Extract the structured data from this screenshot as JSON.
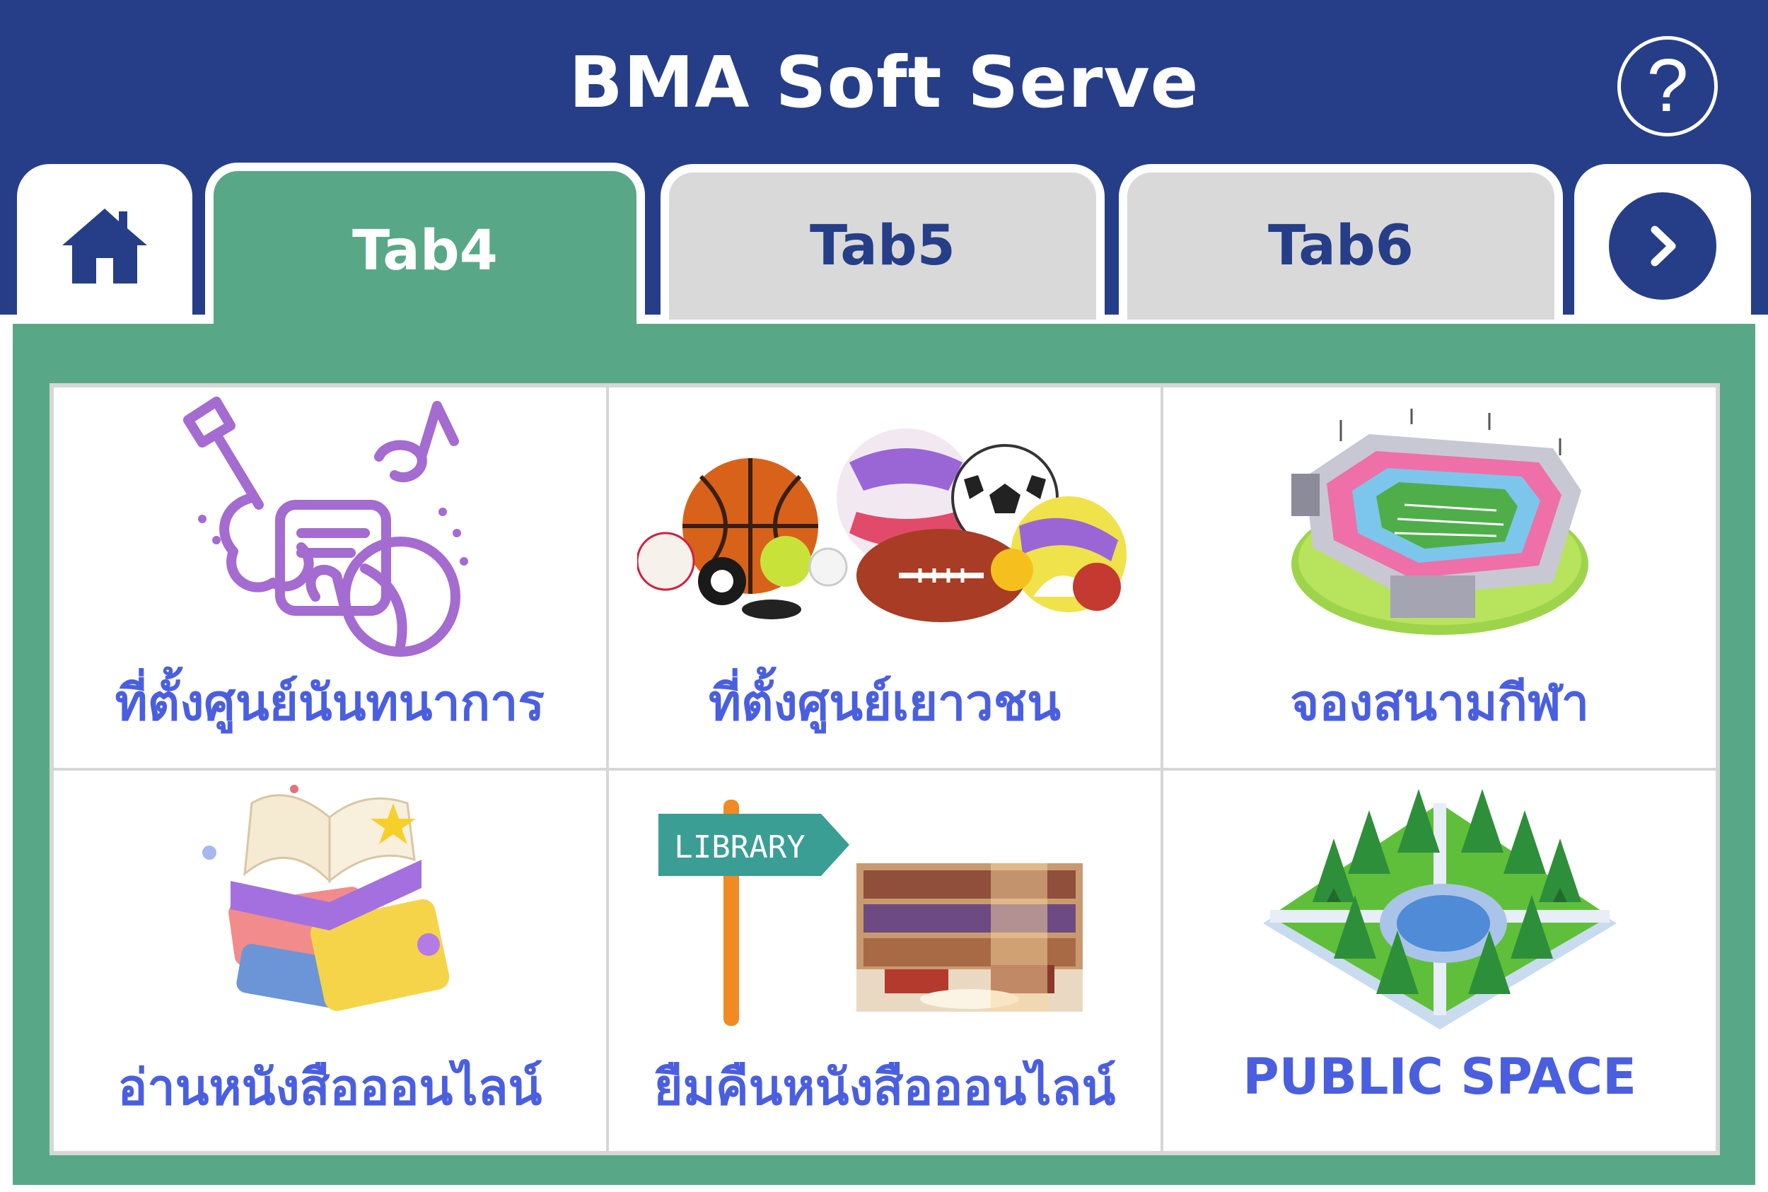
{
  "header": {
    "title": "BMA Soft Serve",
    "help_label": "?",
    "background": "#263e88"
  },
  "tabs": [
    {
      "label": "",
      "icon": "home-icon",
      "active": false
    },
    {
      "label": "Tab4",
      "active": true
    },
    {
      "label": "Tab5",
      "active": false
    },
    {
      "label": "Tab6",
      "active": false
    },
    {
      "label": "",
      "icon": "chevron-right-icon",
      "active": false
    }
  ],
  "colors": {
    "navy": "#263e88",
    "green": "#58a887",
    "inactive_tab": "#d9d9d9",
    "label_blue": "#4a5fe0"
  },
  "tiles": [
    {
      "label": "ที่ตั้งศูนย์นันทนาการ",
      "icon": "recreation-music-icon"
    },
    {
      "label": "ที่ตั้งศูนย์เยาวชน",
      "icon": "sports-balls-icon"
    },
    {
      "label": "จองสนามกีฬา",
      "icon": "stadium-icon"
    },
    {
      "label": "อ่านหนังสือออนไลน์",
      "icon": "open-books-icon"
    },
    {
      "label": "ยืมคืนหนังสือออนไลน์",
      "icon": "library-sign-icon",
      "sign_text": "LIBRARY"
    },
    {
      "label": "PUBLIC SPACE",
      "icon": "park-icon"
    }
  ]
}
